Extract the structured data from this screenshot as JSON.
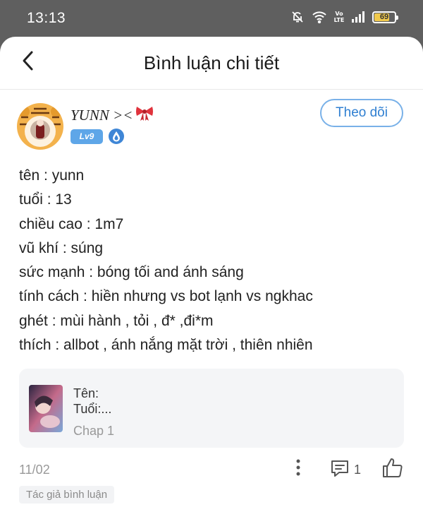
{
  "status_bar": {
    "time": "13:13",
    "network_label": "Vo LTE",
    "battery": "69"
  },
  "header": {
    "title": "Bình luận chi tiết"
  },
  "author": {
    "name": "YUNN ><",
    "level": "Lv9",
    "follow_label": "Theo dõi"
  },
  "content": {
    "lines": [
      "tên : yunn",
      "tuổi : 13",
      "chiều cao : 1m7",
      "vũ khí : súng",
      "sức mạnh : bóng tối and ánh sáng",
      "tính cách : hiền nhưng vs bot lạnh vs ngkhac",
      "ghét : mùi hành , tỏi , đ* ,đi*m",
      "thích : allbot , ánh nắng mặt trời , thiên nhiên"
    ]
  },
  "chapter_card": {
    "lines": [
      "Tên:",
      "Tuổi:..."
    ],
    "chapter": "Chap 1"
  },
  "footer": {
    "date": "11/02",
    "comment_count": "1",
    "author_tag": "Tác giả bình luận"
  },
  "colors": {
    "accent": "#2f7fd1",
    "level_badge": "#5ea6e8",
    "status_bar": "#5f5f5f",
    "battery": "#f0c94c"
  },
  "icons": {
    "back": "chevron-left-icon",
    "mute": "bell-off-icon",
    "wifi": "wifi-icon",
    "signal": "signal-icon",
    "bow": "ribbon-bow-icon",
    "more": "more-vertical-icon",
    "comment": "comment-icon",
    "like": "thumbs-up-icon"
  }
}
